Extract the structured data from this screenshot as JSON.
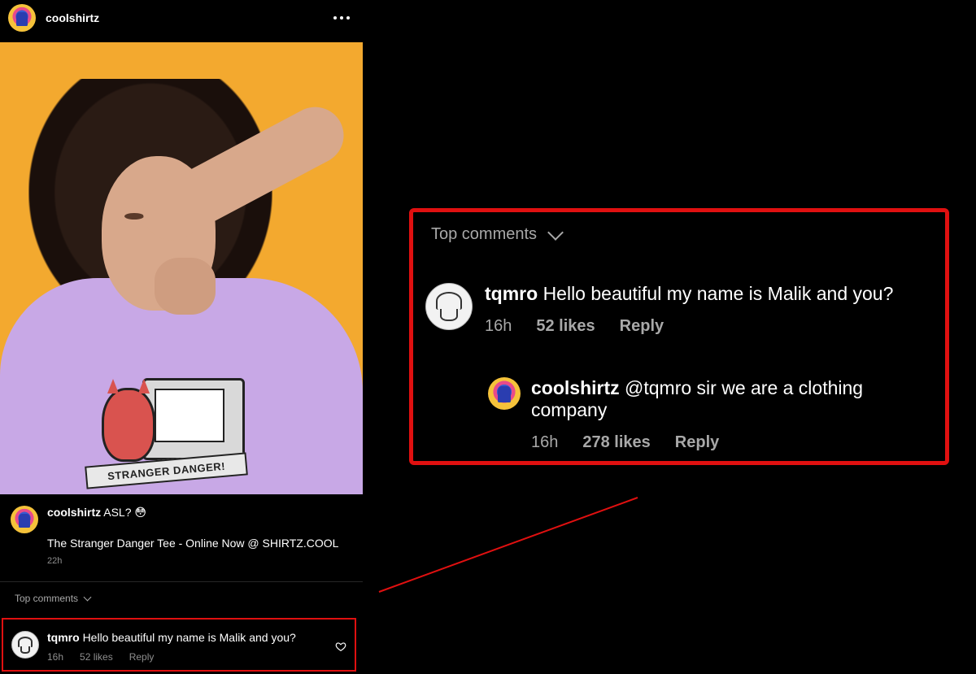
{
  "post": {
    "username": "coolshirtz",
    "caption_text": "ASL? 😳",
    "caption_line2": "The Stranger Danger Tee - Online Now @ SHIRTZ.COOL",
    "caption_time": "22h",
    "shirt_graphic_text": "STRANGER DANGER!"
  },
  "comments_small": {
    "header": "Top comments",
    "items": [
      {
        "username": "tqmro",
        "text": "Hello beautiful my name is Malik and you?",
        "time": "16h",
        "likes": "52 likes",
        "reply": "Reply"
      }
    ]
  },
  "comments_zoom": {
    "header": "Top comments",
    "items": [
      {
        "username": "tqmro",
        "text": "Hello beautiful my name is Malik and you?",
        "time": "16h",
        "likes": "52 likes",
        "reply": "Reply"
      },
      {
        "username": "coolshirtz",
        "text": "@tqmro sir we are a clothing company",
        "time": "16h",
        "likes": "278 likes",
        "reply": "Reply"
      }
    ]
  },
  "colors": {
    "background": "#000000",
    "highlight": "#e01010",
    "photo_bg": "#f3a92f",
    "shirt": "#c8a8e6",
    "muted_text": "#a8a8a8"
  },
  "icons": [
    "more-icon",
    "shopping-bag-icon",
    "chevron-down-icon",
    "heart-icon"
  ]
}
